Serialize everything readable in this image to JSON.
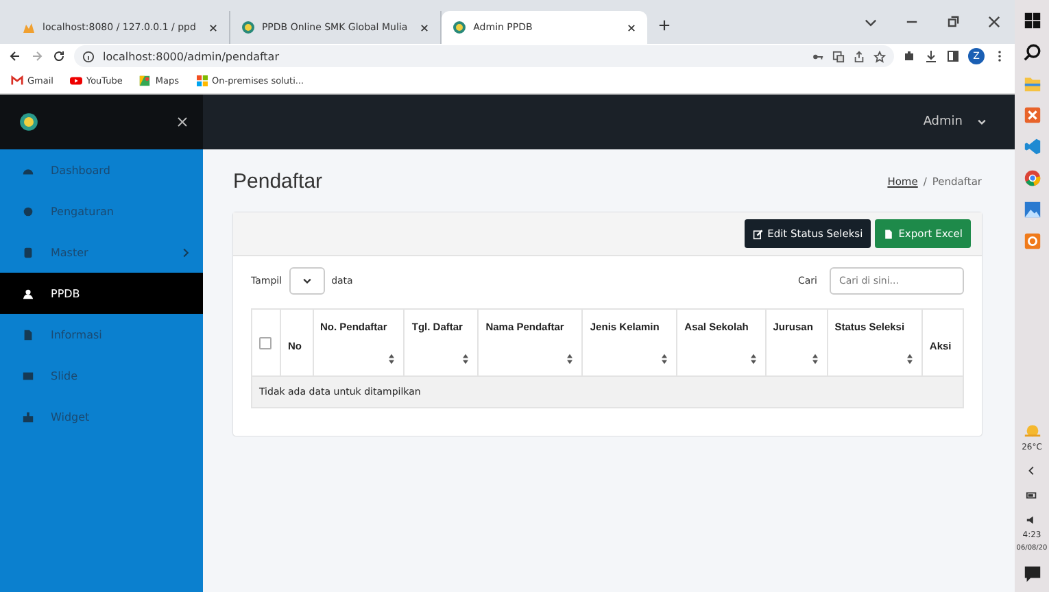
{
  "browser": {
    "tabs": [
      {
        "title": "localhost:8080 / 127.0.0.1 / ppd",
        "selected": false
      },
      {
        "title": "PPDB Online SMK Global Mulia",
        "selected": false
      },
      {
        "title": "Admin PPDB",
        "selected": true
      }
    ],
    "address": "localhost:8000/admin/pendaftar",
    "account_initial": "Z",
    "bookmarks": [
      {
        "label": "Gmail"
      },
      {
        "label": "YouTube"
      },
      {
        "label": "Maps"
      },
      {
        "label": "On-premises soluti..."
      }
    ]
  },
  "app": {
    "user": "Admin",
    "sidebar": [
      {
        "label": "Dashboard",
        "selected": false,
        "has_submenu": false
      },
      {
        "label": "Pengaturan",
        "selected": false,
        "has_submenu": false
      },
      {
        "label": "Master",
        "selected": false,
        "has_submenu": true
      },
      {
        "label": "PPDB",
        "selected": true,
        "has_submenu": false
      },
      {
        "label": "Informasi",
        "selected": false,
        "has_submenu": false
      },
      {
        "label": "Slide",
        "selected": false,
        "has_submenu": false
      },
      {
        "label": "Widget",
        "selected": false,
        "has_submenu": false
      }
    ],
    "page_title": "Pendaftar",
    "breadcrumb_separator": "/",
    "breadcrumb": [
      {
        "label": "Home",
        "link": true
      },
      {
        "label": "Pendaftar",
        "link": false
      }
    ],
    "actions": [
      {
        "label": "Edit Status Seleksi",
        "kind": "dark"
      },
      {
        "label": "Export Excel",
        "kind": "success"
      }
    ],
    "length_label_before": "Tampil",
    "length_label_after": "data",
    "search_label": "Cari",
    "search": {
      "placeholder": "Cari di sini..."
    },
    "table": {
      "columns": [
        {
          "label": "No",
          "sortable": false
        },
        {
          "label": "No. Pendaftar",
          "sortable": true
        },
        {
          "label": "Tgl. Daftar",
          "sortable": true
        },
        {
          "label": "Nama Pendaftar",
          "sortable": true
        },
        {
          "label": "Jenis Kelamin",
          "sortable": true
        },
        {
          "label": "Asal Sekolah",
          "sortable": true
        },
        {
          "label": "Jurusan",
          "sortable": true
        },
        {
          "label": "Status Seleksi",
          "sortable": true
        },
        {
          "label": "Aksi",
          "sortable": false
        }
      ],
      "select_all_checked": false,
      "empty_message": "Tidak ada data untuk ditampilkan"
    }
  },
  "taskbar": {
    "temperature": "26°C",
    "time": "4:23",
    "date": "06/08/20"
  }
}
